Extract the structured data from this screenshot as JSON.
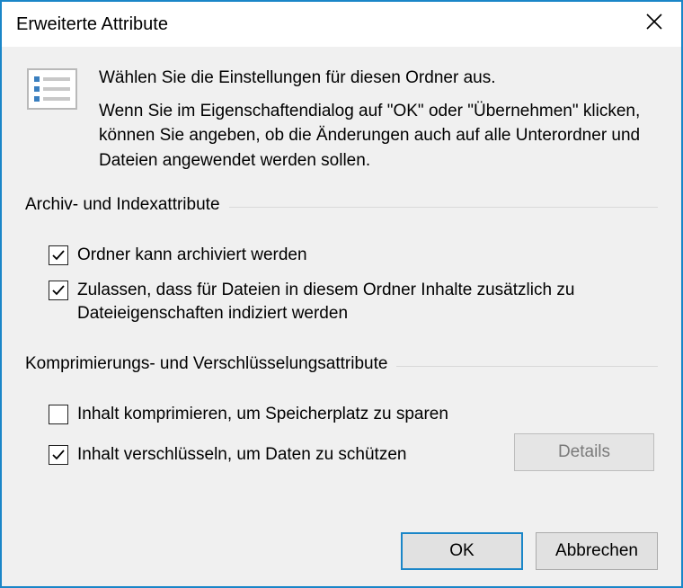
{
  "title": "Erweiterte Attribute",
  "intro": {
    "line1": "Wählen Sie die Einstellungen für diesen Ordner aus.",
    "line2": "Wenn Sie im Eigenschaftendialog auf \"OK\" oder \"Übernehmen\" klicken, können Sie angeben, ob die Änderungen auch auf alle Unterordner und Dateien angewendet werden sollen."
  },
  "group1": {
    "label": "Archiv- und Indexattribute",
    "check_archive": {
      "label": "Ordner kann archiviert werden",
      "checked": true
    },
    "check_index": {
      "label": "Zulassen, dass für Dateien in diesem Ordner Inhalte zusätzlich zu Dateieigenschaften indiziert werden",
      "checked": true
    }
  },
  "group2": {
    "label": "Komprimierungs- und Verschlüsselungsattribute",
    "check_compress": {
      "label": "Inhalt komprimieren, um Speicherplatz zu sparen",
      "checked": false
    },
    "check_encrypt": {
      "label": "Inhalt verschlüsseln, um Daten zu schützen",
      "checked": true
    },
    "details_label": "Details"
  },
  "buttons": {
    "ok": "OK",
    "cancel": "Abbrechen"
  }
}
